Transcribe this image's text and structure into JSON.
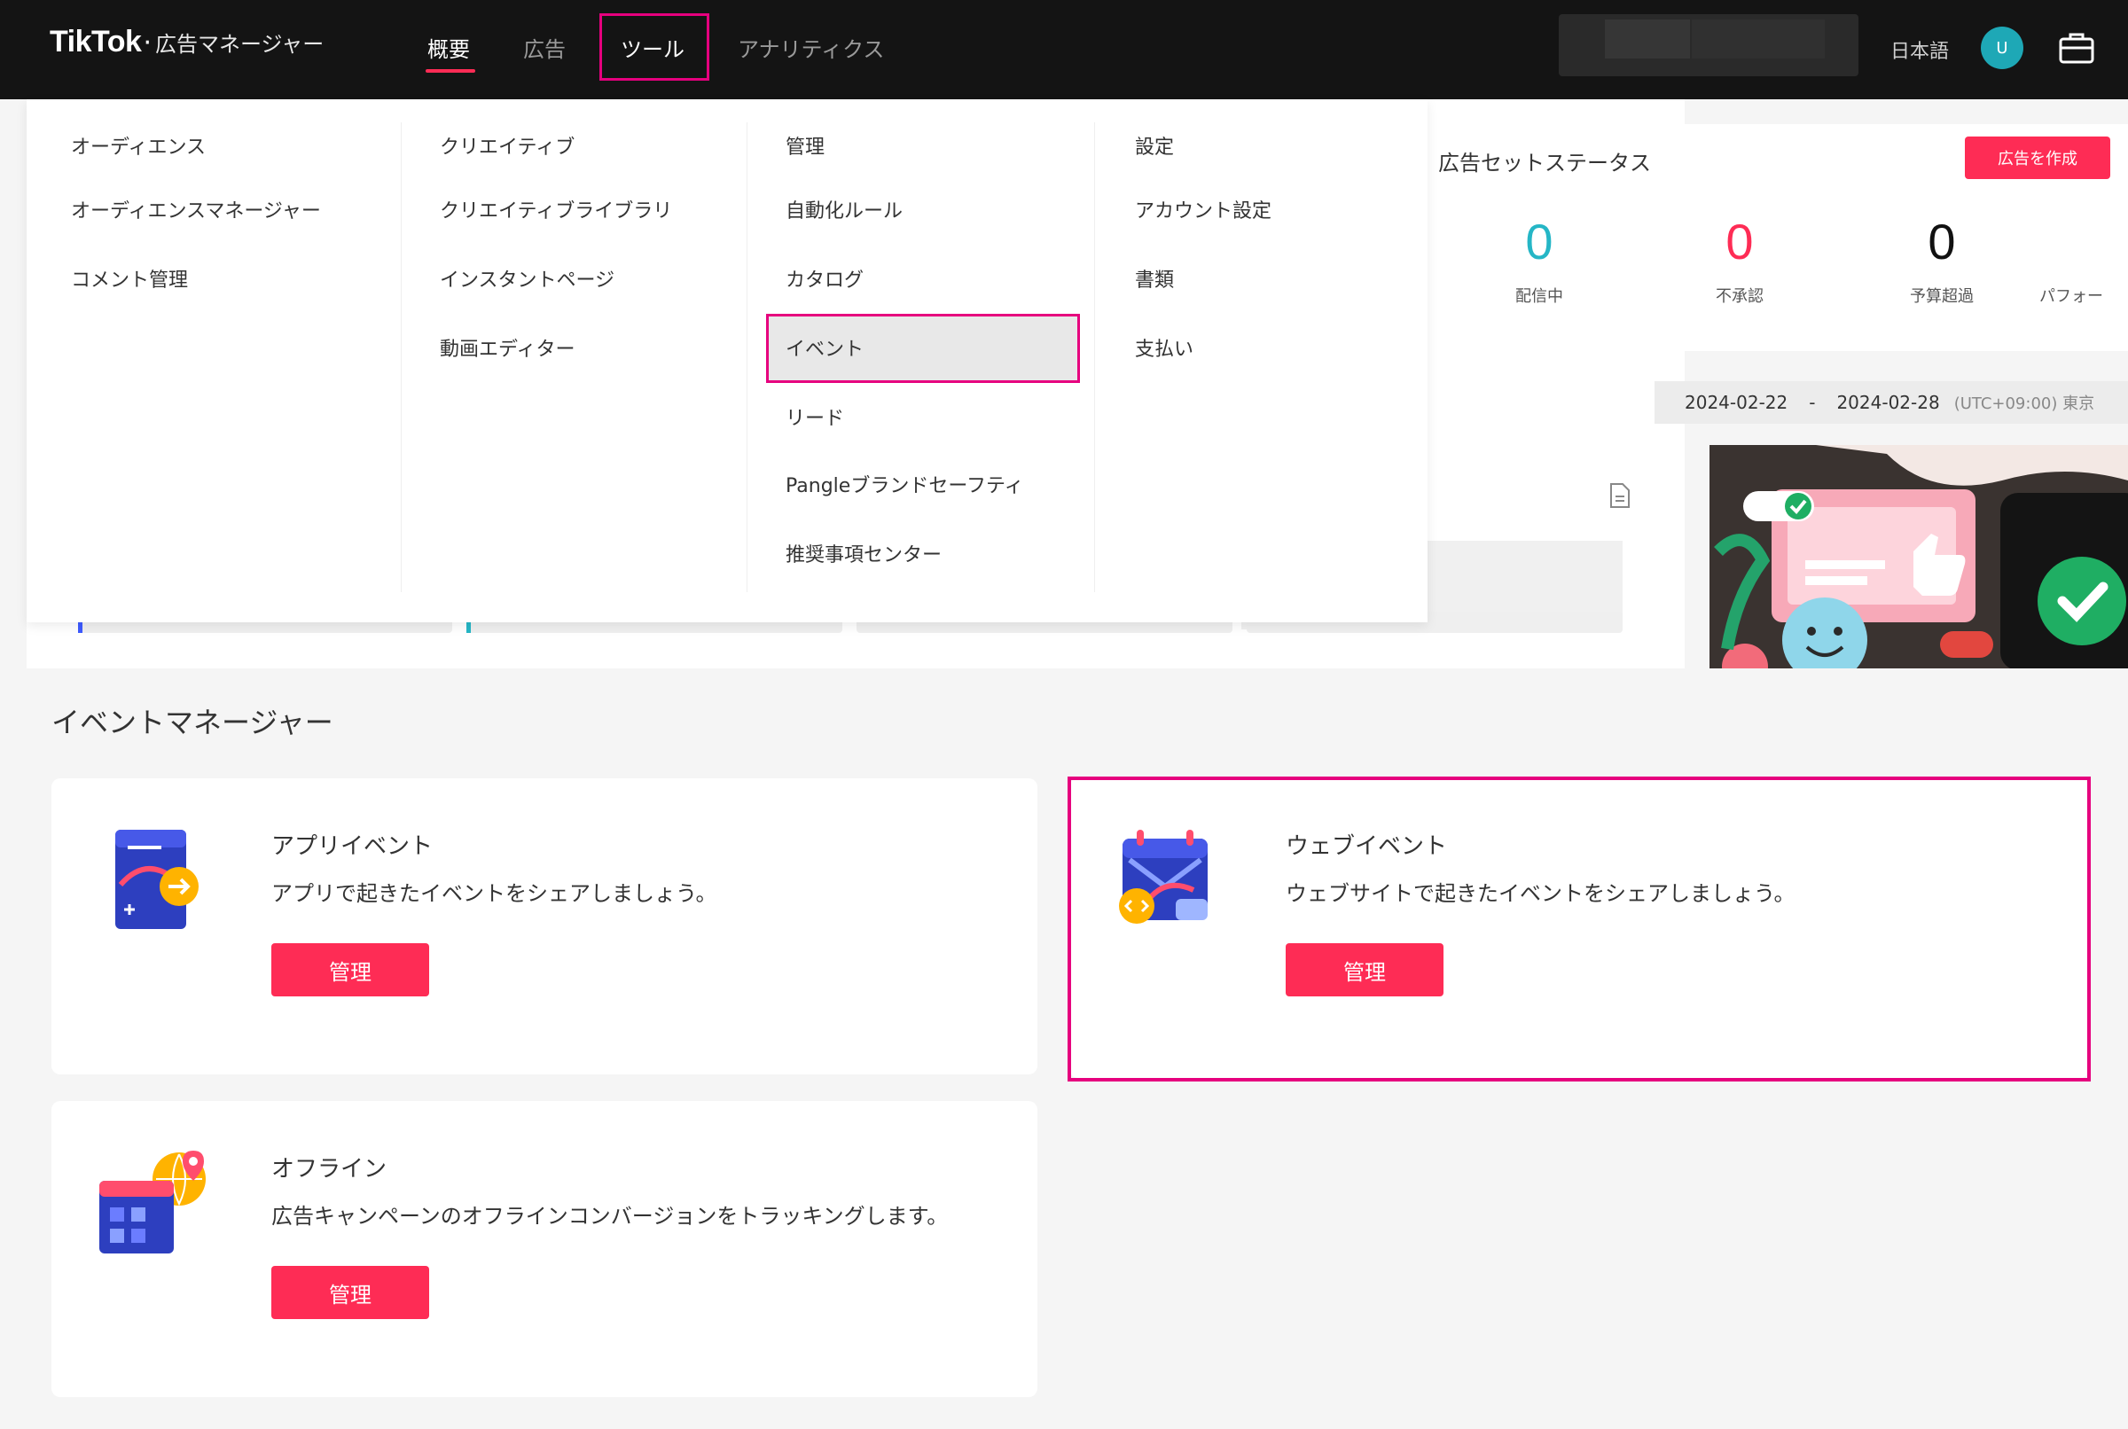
{
  "topbar": {
    "brand": "TikTok",
    "separator": "·",
    "product": "広告マネージャー",
    "nav": [
      {
        "label": "概要"
      },
      {
        "label": "広告"
      },
      {
        "label": "ツール"
      },
      {
        "label": "アナリティクス"
      }
    ],
    "language": "日本語",
    "avatar_initial": "U"
  },
  "dashboard": {
    "status_title": "広告セットステータス",
    "create_button": "広告を作成",
    "stats": [
      {
        "value": "0",
        "label": "配信中",
        "color": "#25b6c6"
      },
      {
        "value": "0",
        "label": "不承認",
        "color": "#fe2c55"
      },
      {
        "value": "0",
        "label": "予算超過",
        "color": "#111111"
      },
      {
        "value": "",
        "label": "パフォー",
        "color": "#111111"
      }
    ],
    "date_start": "2024-02-22",
    "date_sep": "-",
    "date_end": "2024-02-28",
    "timezone": "(UTC+09:00) 東京"
  },
  "dropdown": {
    "columns": [
      {
        "items": [
          "オーディエンス",
          "オーディエンスマネージャー",
          "コメント管理"
        ]
      },
      {
        "items": [
          "クリエイティブ",
          "クリエイティブライブラリ",
          "インスタントページ",
          "動画エディター"
        ]
      },
      {
        "items": [
          "管理",
          "自動化ルール",
          "カタログ",
          "イベント",
          "リード",
          "Pangleブランドセーフティ",
          "推奨事項センター"
        ]
      },
      {
        "items": [
          "設定",
          "アカウント設定",
          "書類",
          "支払い"
        ]
      }
    ]
  },
  "event_manager": {
    "title": "イベントマネージャー",
    "cards": [
      {
        "title": "アプリイベント",
        "desc": "アプリで起きたイベントをシェアしましょう。",
        "button": "管理"
      },
      {
        "title": "ウェブイベント",
        "desc": "ウェブサイトで起きたイベントをシェアしましょう。",
        "button": "管理"
      },
      {
        "title": "オフライン",
        "desc": "広告キャンペーンのオフラインコンバージョンをトラッキングします。",
        "button": "管理"
      }
    ]
  },
  "colors": {
    "accent": "#fe2c55",
    "highlight": "#e6007e",
    "topbar": "#141414"
  }
}
